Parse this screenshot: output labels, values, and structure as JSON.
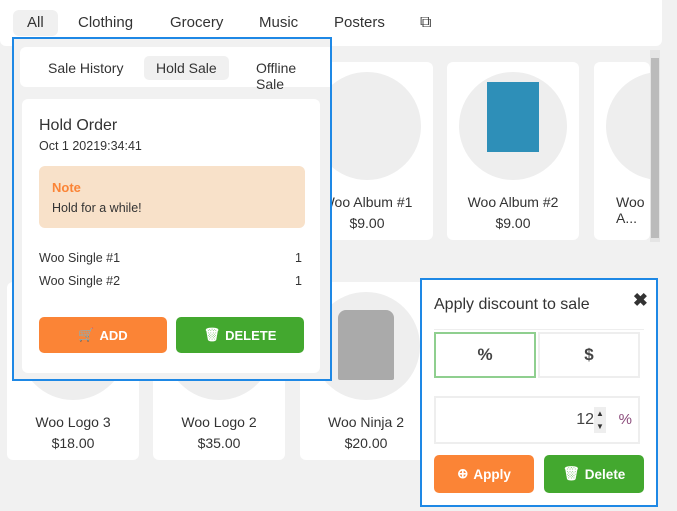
{
  "categories": [
    "All",
    "Clothing",
    "Grocery",
    "Music",
    "Posters"
  ],
  "external_icon": "external-link-icon",
  "products_row1": [
    {
      "name": "Woo Album #1",
      "price": "$9.00"
    },
    {
      "name": "Woo Album #2",
      "price": "$9.00"
    },
    {
      "name": "Woo A...",
      "price": ""
    }
  ],
  "products_row2": [
    {
      "name": "Woo Logo 3",
      "price": "$18.00"
    },
    {
      "name": "Woo Logo 2",
      "price": "$35.00"
    },
    {
      "name": "Woo Ninja 2",
      "price": "$20.00"
    }
  ],
  "sale_panel": {
    "tabs": [
      "Sale History",
      "Hold Sale",
      "Offline Sale"
    ],
    "title": "Hold Order",
    "date": "Oct 1 20219:34:41",
    "note_label": "Note",
    "note_text": "Hold for a while!",
    "items": [
      {
        "name": "Woo Single #1",
        "qty": "1"
      },
      {
        "name": "Woo Single #2",
        "qty": "1"
      }
    ],
    "add_label": "ADD",
    "delete_label": "DELETE"
  },
  "discount": {
    "title": "Apply discount to sale",
    "percent_label": "%",
    "dollar_label": "$",
    "value": "12",
    "unit": "%",
    "apply_label": "Apply",
    "delete_label": "Delete"
  },
  "colors": {
    "accent": "#1e88e5",
    "orange": "#fb8436",
    "green": "#43a82f",
    "note_bg": "#f8e1c9"
  }
}
